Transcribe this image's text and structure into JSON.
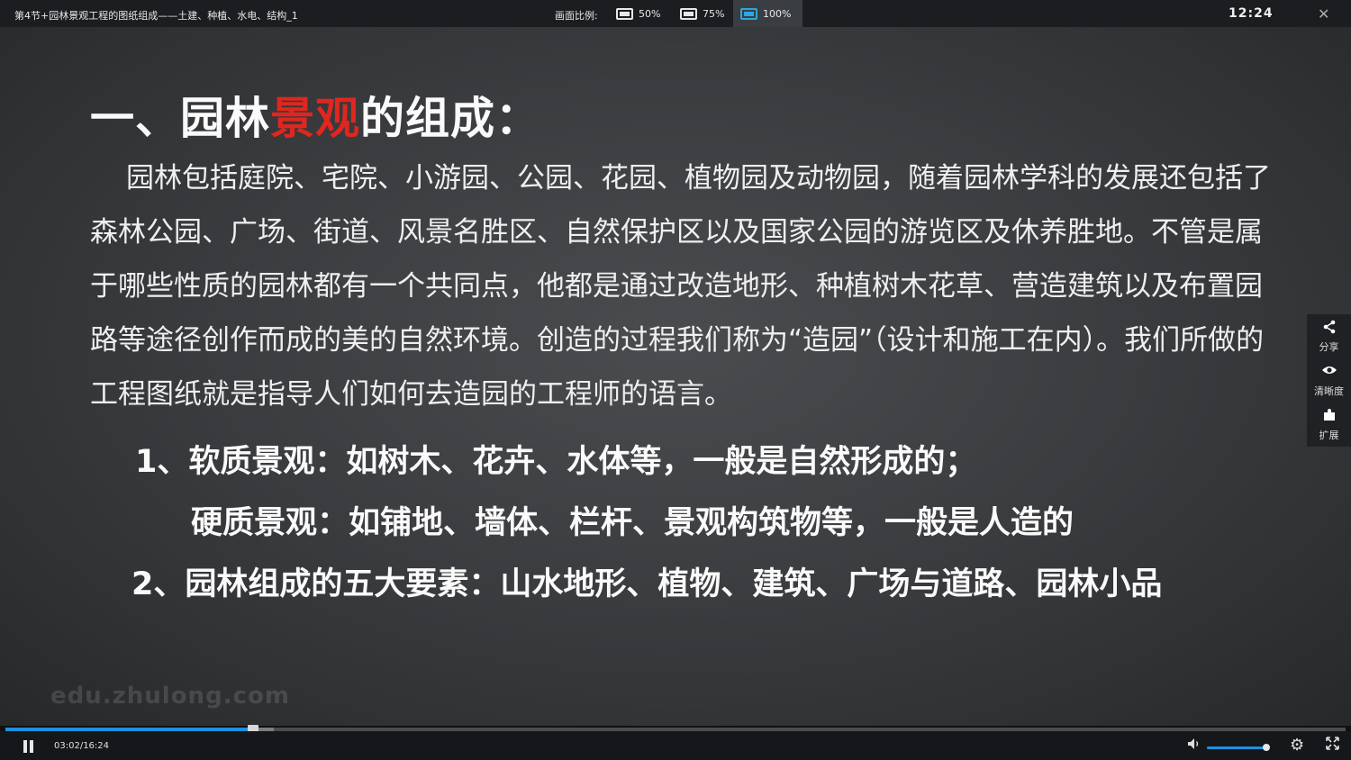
{
  "player": {
    "title": "第4节+园林景观工程的图纸组成——土建、种植、水电、结构_1",
    "ratio_label": "画面比例:",
    "ratio_options": [
      "50%",
      "75%",
      "100%"
    ],
    "ratio_selected": "100%",
    "clock": "12:24"
  },
  "slide": {
    "heading_prefix": "一、园林",
    "heading_highlight": "景观",
    "heading_suffix": "的组成：",
    "paragraph": "园林包括庭院、宅院、小游园、公园、花园、植物园及动物园，随着园林学科的发展还包括了森林公园、广场、街道、风景名胜区、自然保护区以及国家公园的游览区及休养胜地。不管是属于哪些性质的园林都有一个共同点，他都是通过改造地形、种植树木花草、营造建筑以及布置园路等途径创作而成的美的自然环境。创造的过程我们称为“造园”（设计和施工在内）。我们所做的工程图纸就是指导人们如何去造园的工程师的语言。",
    "point1": "1、软质景观：如树木、花卉、水体等，一般是自然形成的；",
    "point1b": "硬质景观：如铺地、墙体、栏杆、景观构筑物等，一般是人造的",
    "point2": "2、园林组成的五大要素：山水地形、植物、建筑、广场与道路、园林小品",
    "highlight_color": "#e0261e"
  },
  "watermark": "edu.zhulong.com",
  "side_panel": {
    "share": "分享",
    "clarity": "清晰度",
    "extend": "扩展"
  },
  "controls": {
    "current_time": "03:02",
    "duration": "16:24",
    "time_text": "03:02/16:24",
    "progress_fraction": 0.185,
    "buffered_fraction": 0.2,
    "volume_fraction": 0.97,
    "accent_color": "#1e90e0"
  }
}
